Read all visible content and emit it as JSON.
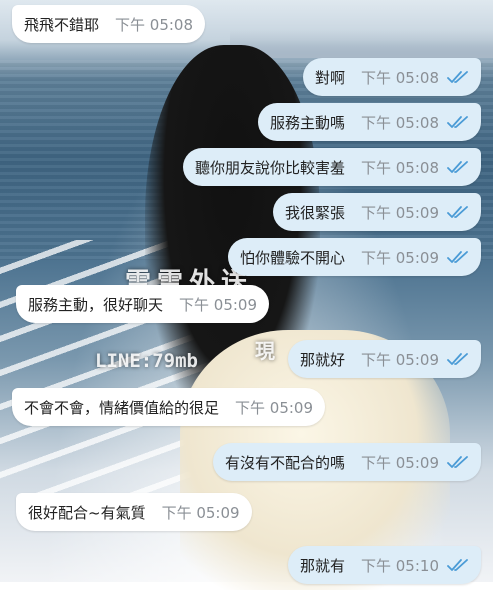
{
  "colors": {
    "incoming_bubble": "#ffffff",
    "outgoing_bubble": "#ddedf8",
    "read_check": "#4a9bd6",
    "time_text": "#8a8f95"
  },
  "watermark": {
    "title": "雪雪外送",
    "line_id": "LINE:79mb",
    "side": "現"
  },
  "messages": [
    {
      "dir": "in",
      "text": "飛飛不錯耶",
      "time": "下午 05:08"
    },
    {
      "dir": "out",
      "text": "對啊",
      "time": "下午 05:08",
      "status_icon": "double-check-icon"
    },
    {
      "dir": "out",
      "text": "服務主動嗎",
      "time": "下午 05:08",
      "status_icon": "double-check-icon"
    },
    {
      "dir": "out",
      "text": "聽你朋友說你比較害羞",
      "time": "下午 05:08",
      "status_icon": "double-check-icon"
    },
    {
      "dir": "out",
      "text": "我很緊張",
      "time": "下午 05:09",
      "status_icon": "double-check-icon"
    },
    {
      "dir": "out",
      "text": "怕你體驗不開心",
      "time": "下午 05:09",
      "status_icon": "double-check-icon"
    },
    {
      "dir": "in",
      "text": "服務主動，很好聊天",
      "time": "下午 05:09"
    },
    {
      "dir": "out",
      "text": "那就好",
      "time": "下午 05:09",
      "status_icon": "double-check-icon"
    },
    {
      "dir": "in",
      "text": "不會不會，情緒價值給的很足",
      "time": "下午 05:09"
    },
    {
      "dir": "out",
      "text": "有沒有不配合的嗎",
      "time": "下午 05:09",
      "status_icon": "double-check-icon"
    },
    {
      "dir": "in",
      "text": "很好配合~有氣質",
      "time": "下午 05:09"
    },
    {
      "dir": "out",
      "text": "那就有",
      "time": "下午 05:10",
      "status_icon": "double-check-icon"
    }
  ]
}
